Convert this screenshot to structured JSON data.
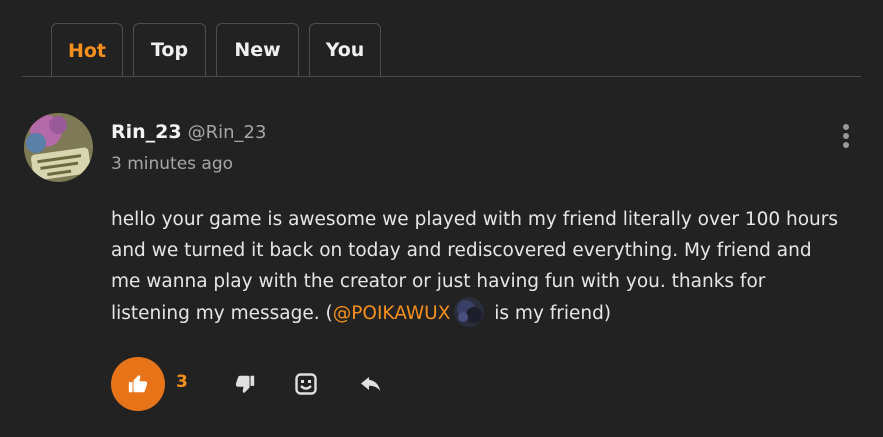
{
  "tabs": [
    {
      "label": "Hot",
      "active": true
    },
    {
      "label": "Top",
      "active": false
    },
    {
      "label": "New",
      "active": false
    },
    {
      "label": "You",
      "active": false
    }
  ],
  "comment": {
    "author_name": "Rin_23",
    "author_handle": "@Rin_23",
    "timestamp": "3 minutes ago",
    "body_part1": "hello your game is awesome we played with my friend literally over 100 hours and we turned it back on today and rediscovered everything. My friend and me wanna play with the creator or just having fun with you. thanks for listening my message. (",
    "mention": "@POIKAWUX",
    "body_part2": " is my friend)",
    "like_count": "3"
  },
  "icons": {
    "like": "thumbs-up-icon",
    "dislike": "thumbs-down-icon",
    "emoji": "emoji-reaction-icon",
    "reply": "reply-icon",
    "more": "more-vertical-icon"
  },
  "colors": {
    "accent": "#f5901e",
    "like_button": "#e8741a",
    "background": "#222222"
  }
}
